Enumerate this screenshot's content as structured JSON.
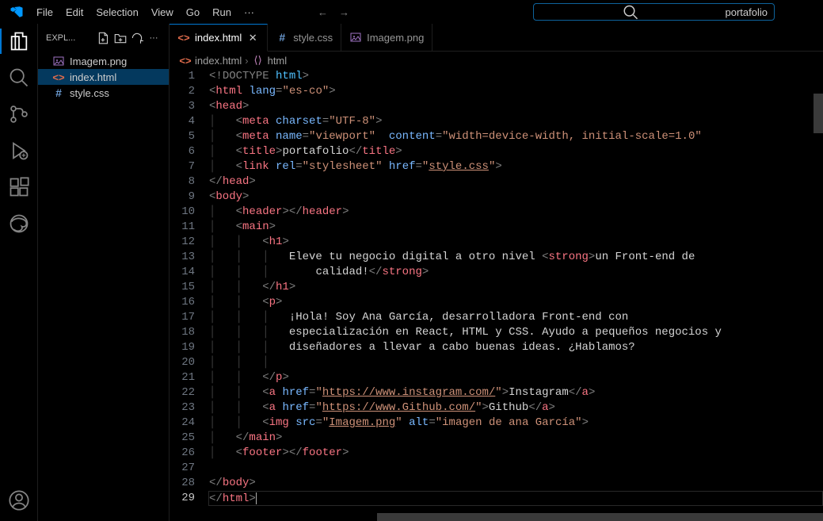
{
  "menubar": [
    "File",
    "Edit",
    "Selection",
    "View",
    "Go",
    "Run",
    "···"
  ],
  "search": {
    "text": "portafolio"
  },
  "sidebar": {
    "title": "EXPL...",
    "files": [
      {
        "icon": "image-icon",
        "iconColor": "#a074c4",
        "label": "Imagem.png",
        "active": false
      },
      {
        "icon": "html-icon",
        "iconColor": "#e06c4c",
        "label": "index.html",
        "active": true
      },
      {
        "icon": "hash-icon",
        "iconColor": "#6b9bd2",
        "label": "style.css",
        "active": false
      }
    ]
  },
  "tabs": [
    {
      "icon": "html-icon",
      "iconColor": "#e06c4c",
      "label": "index.html",
      "active": true,
      "close": true
    },
    {
      "icon": "hash-icon",
      "iconColor": "#6b9bd2",
      "label": "style.css",
      "active": false,
      "close": false
    },
    {
      "icon": "image-icon",
      "iconColor": "#a074c4",
      "label": "Imagem.png",
      "active": false,
      "close": false
    }
  ],
  "breadcrumb": [
    {
      "icon": "html-icon",
      "iconColor": "#e06c4c",
      "label": "index.html"
    },
    {
      "icon": "brackets-icon",
      "iconColor": "#c586c0",
      "label": "html"
    }
  ],
  "code": {
    "lineStart": 1,
    "lineEnd": 29,
    "activeLine": 29,
    "lines": [
      "<span class='br'>&lt;!</span><span class='doctype-kw'>DOCTYPE</span> <span class='doctype-id'>html</span><span class='br'>&gt;</span>",
      "<span class='br'>&lt;</span><span class='tag'>html</span> <span class='attr'>lang</span><span class='br'>=</span><span class='str'>\"es-co\"</span><span class='br'>&gt;</span>",
      "<span class='br'>&lt;</span><span class='tag'>head</span><span class='br'>&gt;</span>",
      "<span class='guide'>│   </span><span class='br'>&lt;</span><span class='tag'>meta</span> <span class='attr'>charset</span><span class='br'>=</span><span class='str'>\"UTF-8\"</span><span class='br'>&gt;</span>",
      "<span class='guide'>│   </span><span class='br'>&lt;</span><span class='tag'>meta</span> <span class='attr'>name</span><span class='br'>=</span><span class='str'>\"viewport\"</span>  <span class='attr'>content</span><span class='br'>=</span><span class='str'>\"width=device-width, initial-scale=1.0\"</span>",
      "<span class='guide'>│   </span><span class='br'>&lt;</span><span class='tag'>title</span><span class='br'>&gt;</span><span class='txt'>portafolio</span><span class='br'>&lt;/</span><span class='tag'>title</span><span class='br'>&gt;</span>",
      "<span class='guide'>│   </span><span class='br'>&lt;</span><span class='tag'>link</span> <span class='attr'>rel</span><span class='br'>=</span><span class='str'>\"stylesheet\"</span> <span class='attr'>href</span><span class='br'>=</span><span class='str'>\"</span><span class='link-url'>style.css</span><span class='str'>\"</span><span class='br'>&gt;</span>",
      "<span class='br'>&lt;/</span><span class='tag'>head</span><span class='br'>&gt;</span>",
      "<span class='br'>&lt;</span><span class='tag'>body</span><span class='br'>&gt;</span>",
      "<span class='guide'>│   </span><span class='br'>&lt;</span><span class='tag'>header</span><span class='br'>&gt;&lt;/</span><span class='tag'>header</span><span class='br'>&gt;</span>",
      "<span class='guide'>│   </span><span class='br'>&lt;</span><span class='tag'>main</span><span class='br'>&gt;</span>",
      "<span class='guide'>│   │   </span><span class='br'>&lt;</span><span class='tag'>h1</span><span class='br'>&gt;</span>",
      "<span class='guide'>│   │   │   </span><span class='txt'>Eleve tu negocio digital a otro nivel </span><span class='br'>&lt;</span><span class='tag'>strong</span><span class='br'>&gt;</span><span class='txt'>un Front-end de</span>",
      "<span class='guide'>│   │   │   </span><span class='guide'>    </span><span class='txt'>calidad!</span><span class='br'>&lt;/</span><span class='tag'>strong</span><span class='br'>&gt;</span>",
      "<span class='guide'>│   │   </span><span class='br'>&lt;/</span><span class='tag'>h1</span><span class='br'>&gt;</span>",
      "<span class='guide'>│   │   </span><span class='br'>&lt;</span><span class='tag'>p</span><span class='br'>&gt;</span>",
      "<span class='guide'>│   │   │   </span><span class='txt'>¡Hola! Soy Ana García, desarrolladora Front-end con</span>",
      "<span class='guide'>│   │   │   </span><span class='txt'>especialización en React, HTML y CSS. Ayudo a pequeños negocios y</span>",
      "<span class='guide'>│   │   │   </span><span class='txt'>diseñadores a llevar a cabo buenas ideas. ¿Hablamos?</span>",
      "<span class='guide'>│   │   │   </span>",
      "<span class='guide'>│   │   </span><span class='br'>&lt;/</span><span class='tag'>p</span><span class='br'>&gt;</span>",
      "<span class='guide'>│   │   </span><span class='br'>&lt;</span><span class='tag'>a</span> <span class='attr'>href</span><span class='br'>=</span><span class='str'>\"</span><span class='link-url'>https://www.instagram.com/</span><span class='str'>\"</span><span class='br'>&gt;</span><span class='txt'>Instagram</span><span class='br'>&lt;/</span><span class='tag'>a</span><span class='br'>&gt;</span>",
      "<span class='guide'>│   │   </span><span class='br'>&lt;</span><span class='tag'>a</span> <span class='attr'>href</span><span class='br'>=</span><span class='str'>\"</span><span class='link-url'>https://www.Github.com/</span><span class='str'>\"</span><span class='br'>&gt;</span><span class='txt'>Github</span><span class='br'>&lt;/</span><span class='tag'>a</span><span class='br'>&gt;</span>",
      "<span class='guide'>│   │   </span><span class='br'>&lt;</span><span class='tag'>img</span> <span class='attr'>src</span><span class='br'>=</span><span class='str'>\"</span><span class='link-url'>Imagem.png</span><span class='str'>\"</span> <span class='attr'>alt</span><span class='br'>=</span><span class='str'>\"imagen de ana García\"</span><span class='br'>&gt;</span>",
      "<span class='guide'>│   </span><span class='br'>&lt;/</span><span class='tag'>main</span><span class='br'>&gt;</span>",
      "<span class='guide'>│   </span><span class='br'>&lt;</span><span class='tag'>footer</span><span class='br'>&gt;&lt;/</span><span class='tag'>footer</span><span class='br'>&gt;</span>",
      "",
      "<span class='br'>&lt;/</span><span class='tag'>body</span><span class='br'>&gt;</span>",
      "<span class='br'>&lt;/</span><span class='tag'>html</span><span class='br'>&gt;</span>"
    ]
  }
}
